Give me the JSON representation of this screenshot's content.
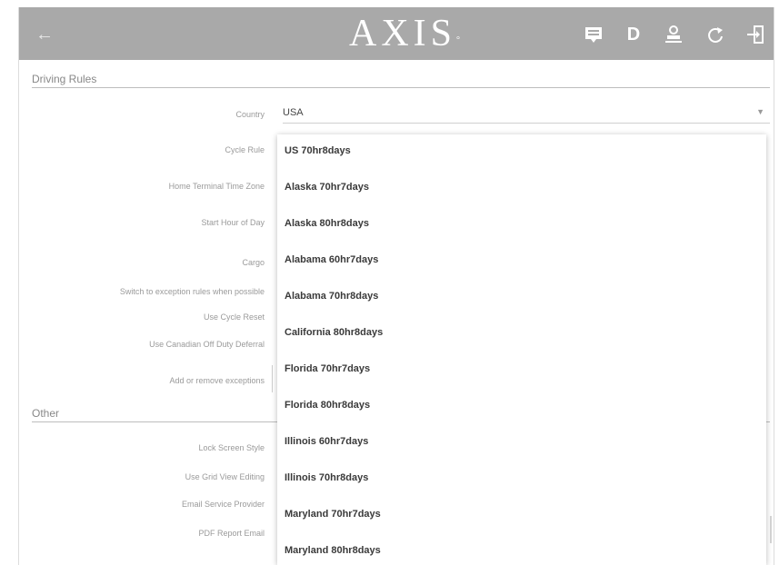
{
  "app": {
    "logo_text": "AXIS"
  },
  "toolbar": {
    "icons": [
      "back-arrow-icon",
      "message-icon",
      "driver-d-icon",
      "user-monitor-icon",
      "refresh-icon",
      "logout-icon"
    ],
    "d_label": "D"
  },
  "sections": {
    "driving_rules": "Driving Rules",
    "other": "Other"
  },
  "fields": {
    "country": {
      "label": "Country",
      "value": "USA"
    },
    "cycle_rule": {
      "label": "Cycle Rule"
    },
    "home_terminal_time_zone": {
      "label": "Home Terminal Time Zone"
    },
    "start_hour_of_day": {
      "label": "Start Hour of Day"
    },
    "cargo": {
      "label": "Cargo"
    },
    "switch_exception": {
      "label": "Switch to exception rules when possible"
    },
    "use_cycle_reset": {
      "label": "Use Cycle Reset"
    },
    "use_canadian_off_duty": {
      "label": "Use Canadian Off Duty Deferral"
    },
    "add_remove_exceptions": {
      "label": "Add or remove exceptions"
    },
    "lock_screen_style": {
      "label": "Lock Screen Style"
    },
    "use_grid_view_editing": {
      "label": "Use Grid View Editing"
    },
    "email_service_provider": {
      "label": "Email Service Provider"
    },
    "pdf_report_email": {
      "label": "PDF Report Email"
    }
  },
  "dropdown": {
    "options": [
      "US 70hr8days",
      "Alaska 70hr7days",
      "Alaska 80hr8days",
      "Alabama 60hr7days",
      "Alabama 70hr8days",
      "California 80hr8days",
      "Florida 70hr7days",
      "Florida 80hr8days",
      "Illinois 60hr7days",
      "Illinois 70hr8days",
      "Maryland 70hr7days",
      "Maryland 80hr8days"
    ]
  },
  "colors": {
    "topbar": "#a9a9a9",
    "background": "#ffffff"
  }
}
